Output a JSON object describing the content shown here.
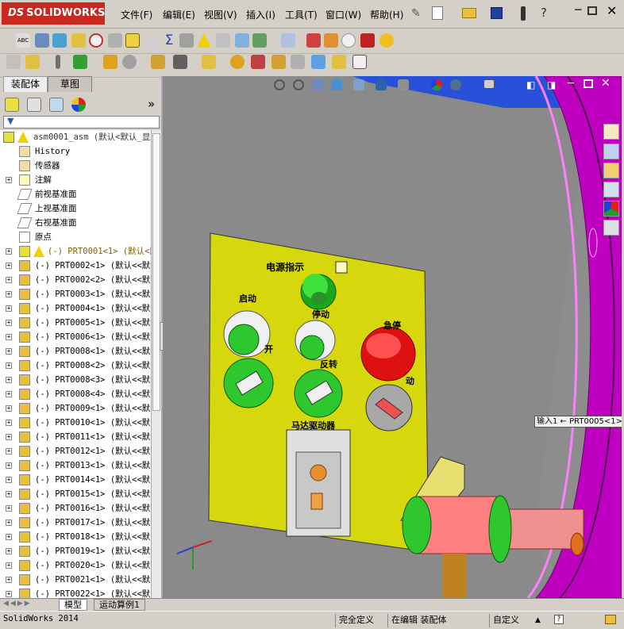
{
  "app": {
    "brand_prefix": "DS",
    "brand": "SOLIDWORKS"
  },
  "menu": [
    "文件(F)",
    "编辑(E)",
    "视图(V)",
    "插入(I)",
    "工具(T)",
    "窗口(W)",
    "帮助(H)"
  ],
  "panel_tabs": {
    "assembly": "装配体",
    "sketch": "草图"
  },
  "tree": {
    "root": "asm0001_asm  (默认<默认_显",
    "items": [
      {
        "label": "History",
        "kind": "history",
        "expander": false
      },
      {
        "label": "传感器",
        "kind": "sensor",
        "expander": false
      },
      {
        "label": "注解",
        "kind": "annotation",
        "expander": true
      },
      {
        "label": "前视基准面",
        "kind": "plane",
        "expander": false
      },
      {
        "label": "上视基准面",
        "kind": "plane",
        "expander": false
      },
      {
        "label": "右视基准面",
        "kind": "plane",
        "expander": false
      },
      {
        "label": "原点",
        "kind": "origin",
        "expander": false
      },
      {
        "label": "(-) PRT0001<1> (默认<默认",
        "kind": "warn",
        "expander": true
      },
      {
        "label": "(-) PRT0002<1> (默认<<默",
        "kind": "part",
        "expander": true
      },
      {
        "label": "(-) PRT0002<2> (默认<<默",
        "kind": "part",
        "expander": true
      },
      {
        "label": "(-) PRT0003<1> (默认<<默",
        "kind": "part",
        "expander": true
      },
      {
        "label": "(-) PRT0004<1> (默认<<默",
        "kind": "part",
        "expander": true
      },
      {
        "label": "(-) PRT0005<1> (默认<<默",
        "kind": "part",
        "expander": true
      },
      {
        "label": "(-) PRT0006<1> (默认<<默",
        "kind": "part",
        "expander": true
      },
      {
        "label": "(-) PRT0008<1> (默认<<默",
        "kind": "part",
        "expander": true
      },
      {
        "label": "(-) PRT0008<2> (默认<<默",
        "kind": "part",
        "expander": true
      },
      {
        "label": "(-) PRT0008<3> (默认<<默",
        "kind": "part",
        "expander": true
      },
      {
        "label": "(-) PRT0008<4> (默认<<默",
        "kind": "part",
        "expander": true
      },
      {
        "label": "(-) PRT0009<1> (默认<<默",
        "kind": "part",
        "expander": true
      },
      {
        "label": "(-) PRT0010<1> (默认<<默",
        "kind": "part",
        "expander": true
      },
      {
        "label": "(-) PRT0011<1> (默认<<默",
        "kind": "part",
        "expander": true
      },
      {
        "label": "(-) PRT0012<1> (默认<<默",
        "kind": "part",
        "expander": true
      },
      {
        "label": "(-) PRT0013<1> (默认<<默",
        "kind": "part",
        "expander": true
      },
      {
        "label": "(-) PRT0014<1> (默认<<默",
        "kind": "part",
        "expander": true
      },
      {
        "label": "(-) PRT0015<1> (默认<<默",
        "kind": "part",
        "expander": true
      },
      {
        "label": "(-) PRT0016<1> (默认<<默",
        "kind": "part",
        "expander": true
      },
      {
        "label": "(-) PRT0017<1> (默认<<默",
        "kind": "part",
        "expander": true
      },
      {
        "label": "(-) PRT0018<1> (默认<<默",
        "kind": "part",
        "expander": true
      },
      {
        "label": "(-) PRT0019<1> (默认<<默",
        "kind": "part",
        "expander": true
      },
      {
        "label": "(-) PRT0020<1> (默认<<默",
        "kind": "part",
        "expander": true
      },
      {
        "label": "(-) PRT0021<1> (默认<<默",
        "kind": "part",
        "expander": true
      },
      {
        "label": "(-) PRT0022<1> (默认<<默",
        "kind": "part",
        "expander": true
      }
    ]
  },
  "panel": {
    "title": "电源指示",
    "labels": {
      "start": "启动",
      "stop_partial": "停动",
      "estop": "急停",
      "on_partial": "开",
      "reverse_partial": "反转",
      "motion_partial": "动",
      "driver": "马达驱动器"
    }
  },
  "tooltip": "输入1 ← PRT0005<1>",
  "bottom_tabs": [
    "模型",
    "运动算例1"
  ],
  "status": {
    "app": "SolidWorks 2014",
    "defined": "完全定义",
    "editing": "在编辑 装配体",
    "custom": "自定义"
  },
  "colors": {
    "viewport_bg": "#8a8a8a",
    "panel_yellow": "#d7d70d",
    "magenta": "#c000c0",
    "green": "#2ec82e",
    "red": "#dd1111"
  }
}
